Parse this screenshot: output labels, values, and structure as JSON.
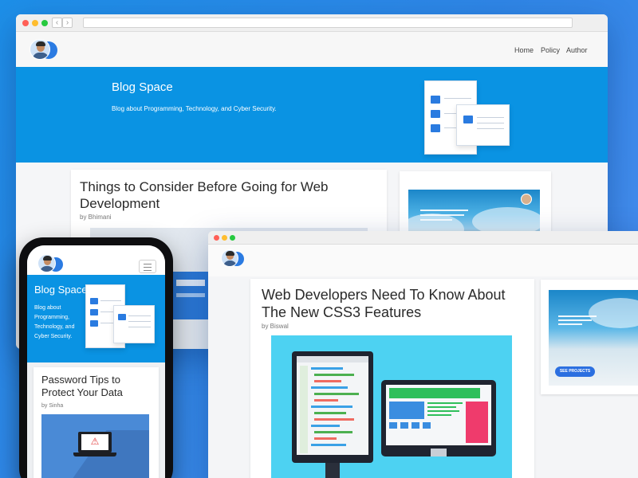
{
  "main_site": {
    "nav": [
      "Home",
      "Policy",
      "Author"
    ],
    "hero": {
      "title": "Blog Space",
      "tagline": "Blog about Programming, Technology, and Cyber Security."
    },
    "post": {
      "title": "Things to Consider Before Going for Web Development",
      "author": "by Bhimani"
    }
  },
  "second_site": {
    "post": {
      "title": "Web Developers Need To Know About The New CSS3 Features",
      "author": "by Biswal"
    },
    "side_button": "SEE PROJECTS"
  },
  "mobile": {
    "hero": {
      "title": "Blog Space",
      "tagline": "Blog about Programming, Technology, and Cyber Security."
    },
    "post": {
      "title": "Password Tips to Protect Your Data",
      "author": "by Sinha"
    }
  },
  "icons": [
    "back-arrow-icon",
    "forward-arrow-icon",
    "hamburger-menu-icon",
    "warning-icon"
  ],
  "colors": {
    "background": "#2f86e6",
    "hero": "#0a93e3",
    "accent": "#2b7be2",
    "art_bg": "#4dd2f2"
  }
}
